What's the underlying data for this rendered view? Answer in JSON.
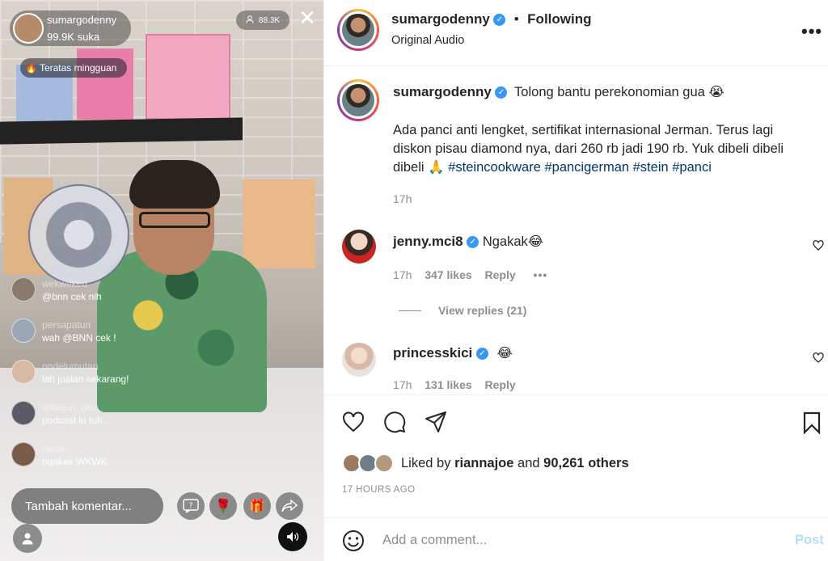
{
  "live": {
    "host_name": "sumargodenny",
    "host_likes": "99.9K suka",
    "viewers": "88.3K",
    "trending_badge": "Teratas mingguan",
    "comments": [
      {
        "user": "wekwekeu",
        "text": "@bnn cek nih"
      },
      {
        "user": "persapatun",
        "text": "wah @BNN cek !"
      },
      {
        "user": "ondelumutan",
        "text": "lah jualan sekarang!"
      },
      {
        "user": "ajibajah_gitu",
        "text": "podcast lu tuh..."
      },
      {
        "user": "rakek",
        "text": "ngakak WKWK"
      }
    ],
    "comment_placeholder": "Tambah komentar..."
  },
  "post": {
    "author": "sumargodenny",
    "follow_state": "Following",
    "audio": "Original Audio",
    "caption_intro": "Tolong bantu perekonomian gua 😭",
    "caption_body": "Ada panci anti lengket, sertifikat internasional Jerman. Terus lagi diskon pisau diamond nya, dari 260 rb jadi 190 rb. Yuk dibeli dibeli dibeli 🙏",
    "hashtags": "#steincookware #pancigerman #stein #panci",
    "caption_time": "17h",
    "comments": [
      {
        "user": "jenny.mci8",
        "text": "Ngakak😂",
        "time": "17h",
        "likes": "347 likes",
        "reply": "Reply",
        "view_replies": "View replies (21)"
      },
      {
        "user": "princesskici",
        "text": "😂",
        "time": "17h",
        "likes": "131 likes",
        "reply": "Reply"
      }
    ],
    "liked_by_prefix": "Liked by",
    "liked_by_user": "riannajoe",
    "liked_by_and": "and",
    "liked_by_count": "90,261 others",
    "timestamp": "17 HOURS AGO",
    "add_comment_placeholder": "Add a comment...",
    "post_button": "Post"
  }
}
